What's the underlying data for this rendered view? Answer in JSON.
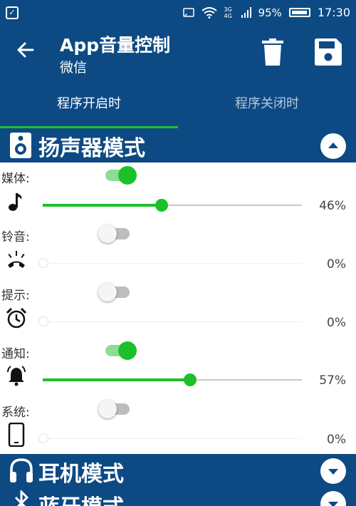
{
  "status_bar": {
    "battery": "95%",
    "time": "17:30",
    "network": "3G 4G"
  },
  "app_bar": {
    "title": "App音量控制",
    "subtitle": "微信"
  },
  "tabs": [
    {
      "label": "程序开启时"
    },
    {
      "label": "程序关闭时"
    }
  ],
  "sections": {
    "speaker": {
      "title": "扬声器模式"
    },
    "headphone": {
      "title": "耳机模式"
    },
    "bluetooth": {
      "title": "蓝牙模式"
    }
  },
  "rows": [
    {
      "label": "媒体:",
      "icon": "music-note-icon",
      "enabled": true,
      "percent": "46%",
      "value": 46
    },
    {
      "label": "铃音:",
      "icon": "phone-ring-icon",
      "enabled": false,
      "percent": "0%",
      "value": 0
    },
    {
      "label": "提示:",
      "icon": "alarm-clock-icon",
      "enabled": false,
      "percent": "0%",
      "value": 0
    },
    {
      "label": "通知:",
      "icon": "bell-icon",
      "enabled": true,
      "percent": "57%",
      "value": 57
    },
    {
      "label": "系统:",
      "icon": "smartphone-icon",
      "enabled": false,
      "percent": "0%",
      "value": 0
    }
  ],
  "colors": {
    "primary": "#0d4a83",
    "accent": "#1cc12a"
  }
}
